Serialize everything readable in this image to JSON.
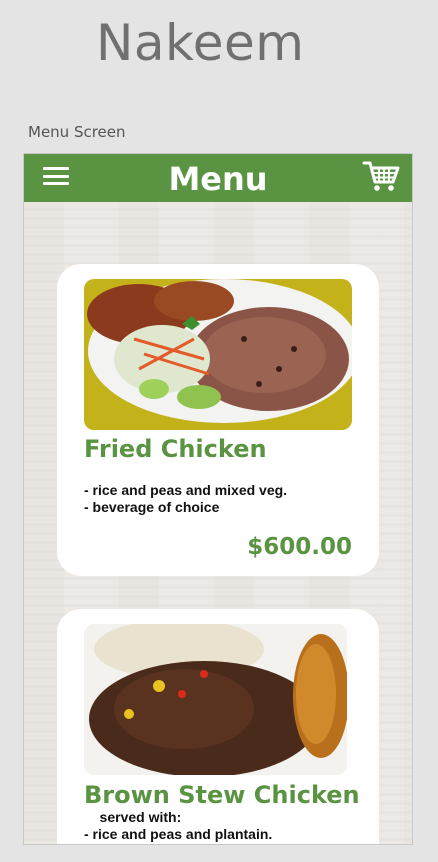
{
  "app": {
    "title": "Nakeem",
    "screen_label": "Menu Screen"
  },
  "topbar": {
    "title": "Menu",
    "menu_icon": "hamburger-menu-icon",
    "cart_icon": "shopping-cart-icon"
  },
  "items": [
    {
      "name": "Fried Chicken",
      "details": [
        "-  rice and peas and mixed veg.",
        "-  beverage of choice"
      ],
      "price": "$600.00"
    },
    {
      "name": "Brown Stew Chicken",
      "details": [
        "    served with:",
        "-  rice and peas and plantain."
      ]
    }
  ],
  "colors": {
    "brand_green": "#5a9341",
    "background": "#e4e4e4",
    "card": "#ffffff"
  }
}
